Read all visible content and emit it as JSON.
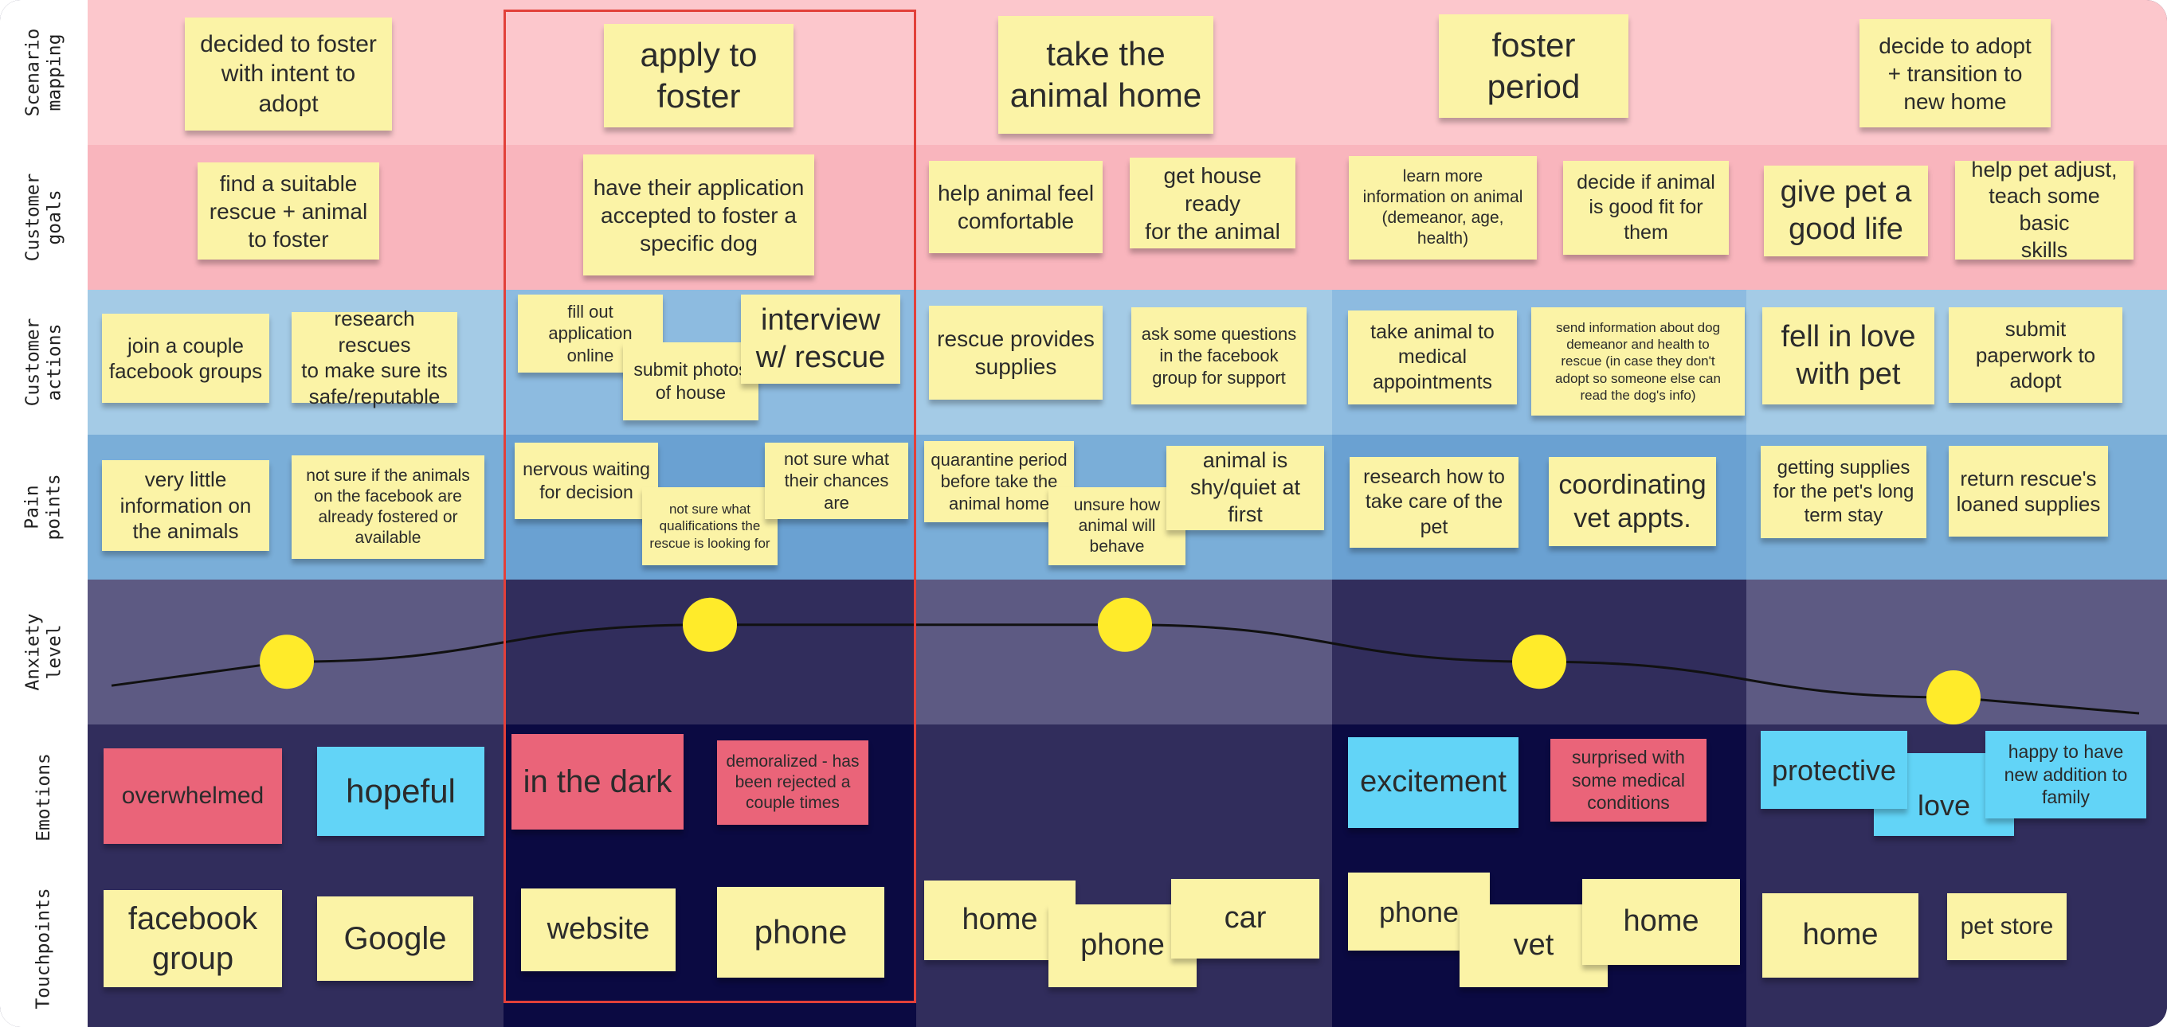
{
  "rows": [
    {
      "id": "scenario",
      "label": "Scenario\nmapping"
    },
    {
      "id": "goals",
      "label": "Customer\ngoals"
    },
    {
      "id": "actions",
      "label": "Customer\nactions"
    },
    {
      "id": "pain",
      "label": "Pain\npoints"
    },
    {
      "id": "anxiety",
      "label": "Anxiety\nlevel"
    },
    {
      "id": "emotions",
      "label": "Emotions"
    },
    {
      "id": "touch",
      "label": "Touchpoints"
    }
  ],
  "colors": {
    "scenario_bg": "#fcc7cc",
    "goals_bg": "#f9b5bd",
    "actions_bg_light": "#a4cbe6",
    "actions_bg_dark": "#8dbbe0",
    "pain_bg_light": "#7aaed8",
    "pain_bg_dark": "#6aa1d2",
    "anxiety_bg_light": "#5d5a83",
    "anxiety_bg_dark": "#312d5c",
    "emotions_bg_light": "#312d5c",
    "emotions_bg_dark": "#0b0a42",
    "touch_bg_light": "#312d5c",
    "touch_bg_dark": "#0b0a42",
    "sticky_yellow": "#fbf3a6",
    "sticky_pink": "#ea6479",
    "sticky_blue": "#62d4f7",
    "anxiety_dot": "#ffeb2a",
    "selection_border": "#e2403a"
  },
  "stickies": {
    "s1": "decided to foster\nwith intent to\nadopt",
    "s2": "apply to\nfoster",
    "s3": "take the\nanimal home",
    "s4": "foster\nperiod",
    "s5": "decide to adopt\n+ transition to\nnew home",
    "g1": "find a suitable\nrescue + animal\nto foster",
    "g2": "have their application\naccepted to foster a\nspecific dog",
    "g3": "help animal feel\ncomfortable",
    "g4": "get house ready\nfor the animal",
    "g5": "learn more\ninformation on animal\n(demeanor, age,\nhealth)",
    "g6": "decide if animal\nis good fit for\nthem",
    "g7": "give pet a\ngood life",
    "g8": "help pet adjust,\nteach some basic\nskills",
    "a1": "join a couple\nfacebook groups",
    "a2": "research rescues\nto make sure its\nsafe/reputable",
    "a3": "fill out\napplication\nonline",
    "a4": "submit photos\nof house",
    "a5": "interview\nw/ rescue",
    "a6": "rescue provides\nsupplies",
    "a7": "ask some questions\nin the facebook\ngroup for support",
    "a8": "take animal to\nmedical\nappointments",
    "a9": "send information about dog\ndemeanor and health to\nrescue (in case they don't\nadopt so someone else can\nread the dog's info)",
    "a10": "fell in love\nwith pet",
    "a11": "submit\npaperwork to\nadopt",
    "p1": "very little\ninformation on\nthe animals",
    "p2": "not sure if the animals\non the facebook are\nalready fostered or\navailable",
    "p3": "nervous waiting\nfor decision",
    "p4": "not sure what\nqualifications the\nrescue is looking for",
    "p5": "not sure what\ntheir chances are",
    "p6": "quarantine period\nbefore take the\nanimal home",
    "p7": "unsure how\nanimal will\nbehave",
    "p8": "animal is\nshy/quiet at first",
    "p9": "research how to\ntake care of the\npet",
    "p10": "coordinating\nvet appts.",
    "p11": "getting supplies\nfor the pet's long\nterm stay",
    "p12": "return rescue's\nloaned supplies",
    "e1": "overwhelmed",
    "e2": "hopeful",
    "e3": "in the dark",
    "e4": "demoralized - has\nbeen rejected a\ncouple times",
    "e5": "excitement",
    "e6": "surprised with\nsome medical\nconditions",
    "e7": "protective",
    "e8": "love",
    "e9": "happy to have\nnew addition to\nfamily",
    "t1": "facebook\ngroup",
    "t2": "Google",
    "t3": "website",
    "t4": "phone",
    "t5": "home",
    "t6": "phone",
    "t7": "car",
    "t8": "phone",
    "t9": "vet",
    "t10": "home",
    "t11": "home",
    "t12": "pet store"
  },
  "anxiety": {
    "scale": "relative (0 = lowest, 1 = highest); no numeric axis shown",
    "levels": [
      0.43,
      0.72,
      0.72,
      0.43,
      0.15
    ]
  }
}
